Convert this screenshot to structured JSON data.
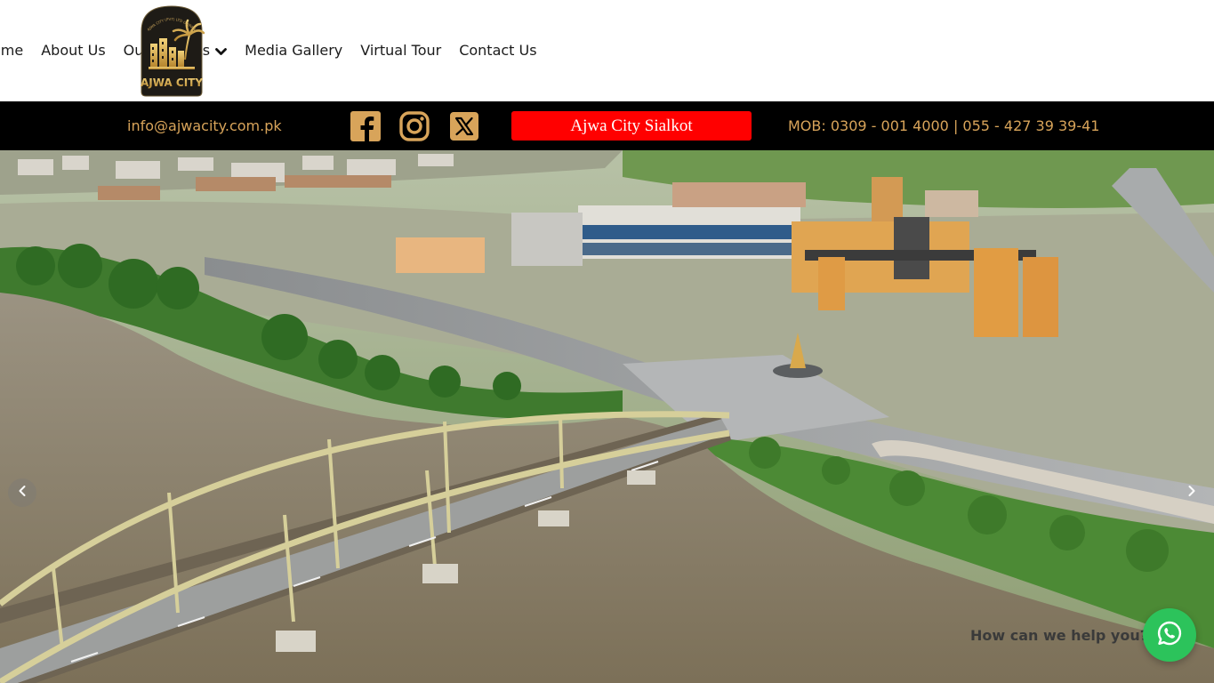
{
  "nav": {
    "items": [
      {
        "label": "ome"
      },
      {
        "label": "About Us"
      },
      {
        "label": "Our Projects"
      },
      {
        "label": "Media Gallery"
      },
      {
        "label": "Virtual Tour"
      },
      {
        "label": "Contact Us"
      }
    ],
    "dropdown_icon": "chevron-down-icon"
  },
  "logo": {
    "text": "AJWA CITY",
    "arc_text": "AJWA CITY (PVT) LTD GUJRANWALA"
  },
  "topbar": {
    "email": "info@ajwacity.com.pk",
    "social_icons": [
      "facebook-icon",
      "instagram-icon",
      "x-icon"
    ],
    "city_button": "Ajwa City Sialkot",
    "mobile": "MOB: 0309 - 001 4000 | 055 - 427 39 39-41"
  },
  "hero": {
    "prev_icon": "chevron-left-icon",
    "next_icon": "chevron-right-icon"
  },
  "chat": {
    "prompt": "How can we help you?",
    "icon": "whatsapp-icon"
  },
  "colors": {
    "topbar_bg": "#000000",
    "gold_text": "#d8a45a",
    "city_button_bg": "#ff0000",
    "whatsapp_green": "#2cc35b"
  }
}
